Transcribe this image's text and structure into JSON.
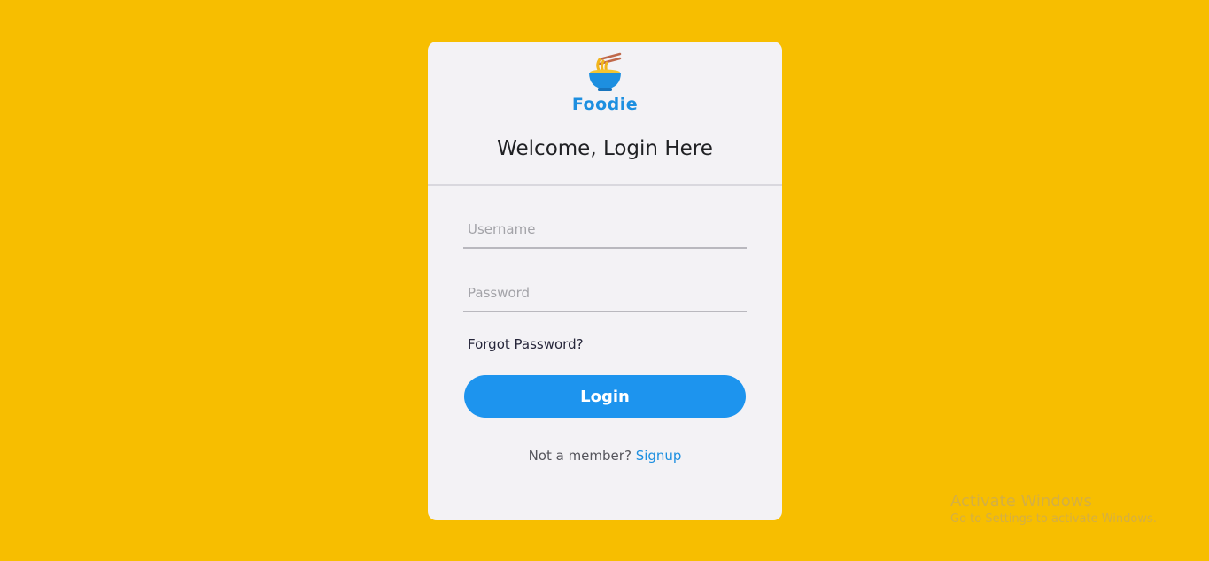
{
  "header": {
    "logo_icon": "noodle-bowl-icon",
    "brand": "Foodie",
    "title": "Welcome, Login Here"
  },
  "form": {
    "username": {
      "value": "",
      "placeholder": "Username"
    },
    "password": {
      "value": "",
      "placeholder": "Password"
    },
    "forgot_label": "Forgot Password?",
    "login_label": "Login",
    "signup_prompt": "Not a member?",
    "signup_link": "Signup"
  },
  "watermark": {
    "title": "Activate Windows",
    "subtitle": "Go to Settings to activate Windows."
  },
  "colors": {
    "background": "#f7be00",
    "card": "#f3f2f5",
    "accent": "#1d94ee",
    "brand": "#1d8fe0"
  }
}
